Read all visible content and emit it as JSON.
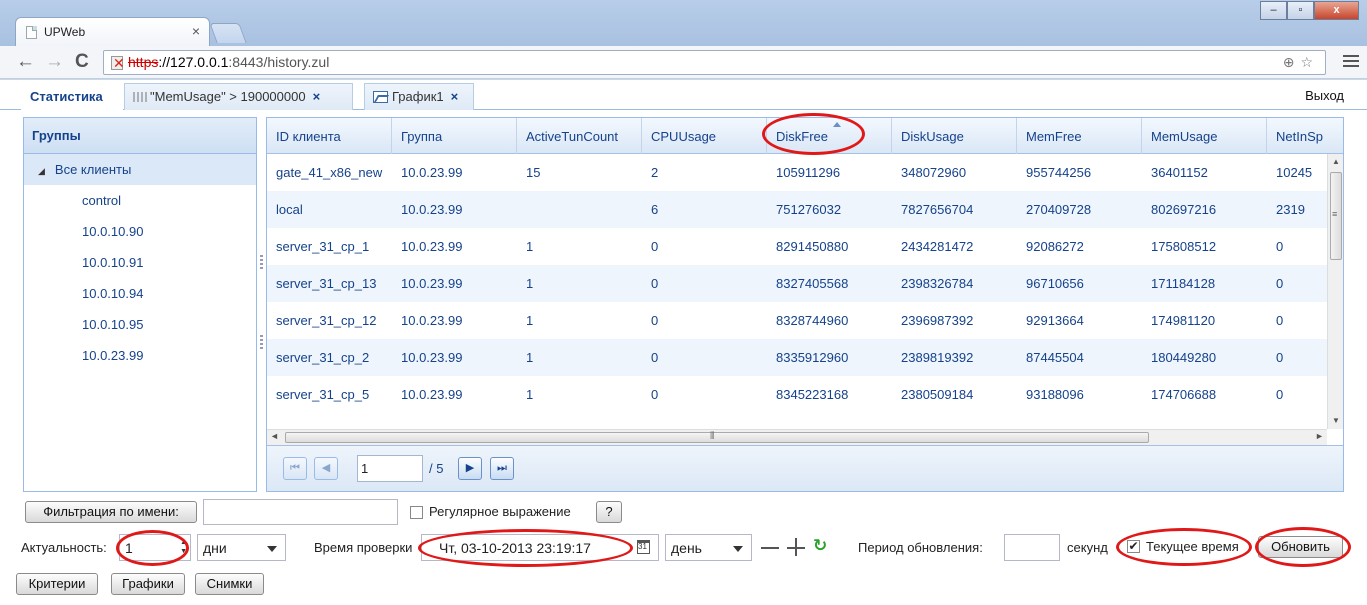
{
  "browser": {
    "tab_title": "UPWeb",
    "tab_close": "×",
    "url_scheme": "https",
    "url_host": "://127.0.0.1",
    "url_rest": ":8443/history.zul",
    "back_icon": "←",
    "forward_icon": "→",
    "reload_icon": "C",
    "url_tools": "⊕☆",
    "win_minimize": "–",
    "win_restore": "▫",
    "win_close": "x"
  },
  "app_tabs": [
    {
      "label": "Статистика",
      "active": true
    },
    {
      "label": "\"MemUsage\" > 190000000",
      "close": "×",
      "icon": "grid-icon"
    },
    {
      "label": "График1",
      "close": "×",
      "icon": "chart-icon"
    }
  ],
  "logout": "Выход",
  "groups": {
    "title": "Группы",
    "root": "Все клиенты",
    "root_toggle": "◢",
    "items": [
      "control",
      "10.0.10.90",
      "10.0.10.91",
      "10.0.10.94",
      "10.0.10.95",
      "10.0.23.99"
    ]
  },
  "grid": {
    "columns": [
      "ID клиента",
      "Группа",
      "ActiveTunCount",
      "CPUUsage",
      "DiskFree",
      "DiskUsage",
      "MemFree",
      "MemUsage",
      "NetInSp"
    ],
    "sorted_column": "DiskFree",
    "rows": [
      [
        "gate_41_x86_new",
        "10.0.23.99",
        "15",
        "2",
        "105911296",
        "348072960",
        "955744256",
        "36401152",
        "10245"
      ],
      [
        "local",
        "10.0.23.99",
        "",
        "6",
        "751276032",
        "7827656704",
        "270409728",
        "802697216",
        "2319"
      ],
      [
        "server_31_cp_1",
        "10.0.23.99",
        "1",
        "0",
        "8291450880",
        "2434281472",
        "92086272",
        "175808512",
        "0"
      ],
      [
        "server_31_cp_13",
        "10.0.23.99",
        "1",
        "0",
        "8327405568",
        "2398326784",
        "96710656",
        "171184128",
        "0"
      ],
      [
        "server_31_cp_12",
        "10.0.23.99",
        "1",
        "0",
        "8328744960",
        "2396987392",
        "92913664",
        "174981120",
        "0"
      ],
      [
        "server_31_cp_2",
        "10.0.23.99",
        "1",
        "0",
        "8335912960",
        "2389819392",
        "87445504",
        "180449280",
        "0"
      ],
      [
        "server_31_cp_5",
        "10.0.23.99",
        "1",
        "0",
        "8345223168",
        "2380509184",
        "93188096",
        "174706688",
        "0"
      ]
    ],
    "scroll_up": "▲",
    "scroll_down": "▼",
    "scroll_grip": "≡",
    "hscroll_left": "◄",
    "hscroll_right": "►",
    "hscroll_grip": "⦀"
  },
  "pager": {
    "first": "⏮",
    "prev": "◀",
    "next": "▶",
    "last": "⏭",
    "current_page": "1",
    "total": "/ 5"
  },
  "filter": {
    "button": "Фильтрация по имени:",
    "value": "",
    "regex_label": "Регулярное выражение",
    "help": "?"
  },
  "controls": {
    "relevance_label": "Актуальность:",
    "relevance_value": "1",
    "relevance_unit": "дни",
    "check_time_label": "Время проверки",
    "check_time_value": "Чт, 03-10-2013 23:19:17",
    "step_unit": "день",
    "refresh_period_label": "Период обновления:",
    "refresh_period_value": "",
    "seconds": "секунд",
    "current_time_label": "Текущее время",
    "current_time_checked": "✔",
    "update_button": "Обновить",
    "refresh_icon": "↻"
  },
  "bottom_buttons": [
    "Критерии",
    "Графики",
    "Снимки"
  ],
  "colors": {
    "accent": "#15428b",
    "highlight": "#e01818"
  }
}
